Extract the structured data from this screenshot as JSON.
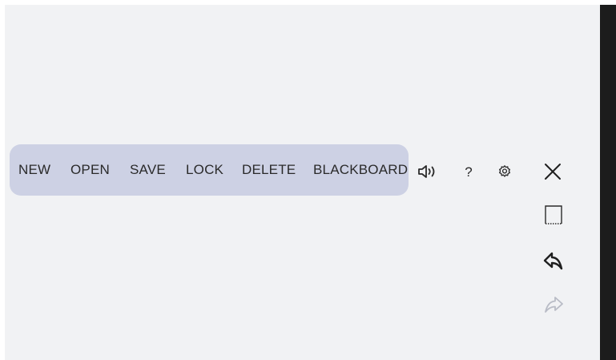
{
  "menu": {
    "items": [
      {
        "label": "NEW"
      },
      {
        "label": "OPEN"
      },
      {
        "label": "SAVE"
      },
      {
        "label": "LOCK"
      },
      {
        "label": "DELETE"
      },
      {
        "label": "BLACKBOARD"
      }
    ]
  },
  "toolbar": {
    "help_label": "?",
    "icons": [
      "speaker-icon",
      "help-icon",
      "gear-icon"
    ]
  },
  "side_tools": {
    "icons": [
      "close-icon",
      "page-bottom-icon",
      "undo-icon",
      "redo-icon"
    ],
    "redo_enabled": false
  },
  "colors": {
    "canvas": "#f1f2f4",
    "menu_background": "#cdd1e4",
    "text": "#2a2a2a",
    "disabled_icon": "#b9bcc6",
    "edge": "#1c1c1c"
  }
}
